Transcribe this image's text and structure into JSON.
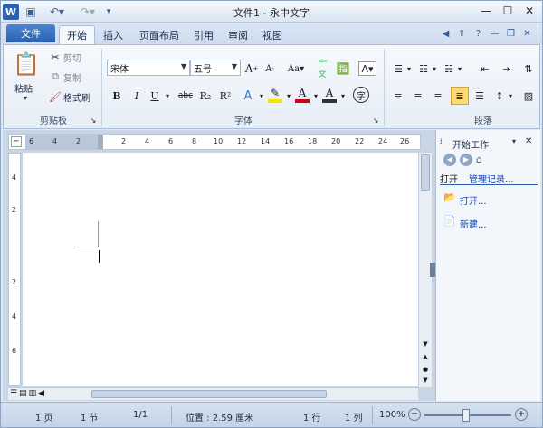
{
  "titlebar": {
    "title": "文件1 - 永中文字",
    "app_icon": "W",
    "quick_access": [
      "save-icon",
      "undo-icon",
      "redo-icon"
    ],
    "controls": [
      "minimize-icon",
      "maximize-icon",
      "close-icon"
    ]
  },
  "tabs": {
    "file": "文件",
    "items": [
      "开始",
      "插入",
      "页面布局",
      "引用",
      "审阅",
      "视图"
    ],
    "active": "开始"
  },
  "ribbon": {
    "clipboard": {
      "label": "剪贴板",
      "paste": "粘贴",
      "cut": "剪切",
      "copy": "复制",
      "format_painter": "格式刷"
    },
    "font": {
      "label": "字体",
      "font_name": "宋体",
      "font_size": "五号",
      "grow": "A",
      "shrink": "A",
      "case": "Aa",
      "bold": "B",
      "italic": "I",
      "underline": "U",
      "strike": "abc",
      "sub": "R₂",
      "sup": "R²",
      "effects": "A",
      "highlight": "✎",
      "color": "A",
      "charshade": "A",
      "enclose": "字"
    },
    "paragraph": {
      "label": "段落"
    }
  },
  "ruler": {
    "h_numbers": [
      "6",
      "4",
      "2",
      "2",
      "4",
      "6",
      "8",
      "10",
      "12",
      "14",
      "16",
      "18",
      "20",
      "22",
      "24",
      "26"
    ],
    "v_numbers": [
      "4",
      "2",
      "2",
      "4",
      "6"
    ]
  },
  "taskpane": {
    "title": "开始工作",
    "tab_open": "打开",
    "tab_manage": "管理记录...",
    "open_link": "打开...",
    "new_link": "新建..."
  },
  "status": {
    "page": "1 页",
    "section": "1 节",
    "pages": "1/1",
    "position": "位置 : 2.59 厘米",
    "line": "1 行",
    "col": "1 列",
    "zoom": "100%"
  },
  "colors": {
    "file_tab": "#2a5fb0",
    "highlight": "#f5e300",
    "font_color": "#d0021b"
  }
}
